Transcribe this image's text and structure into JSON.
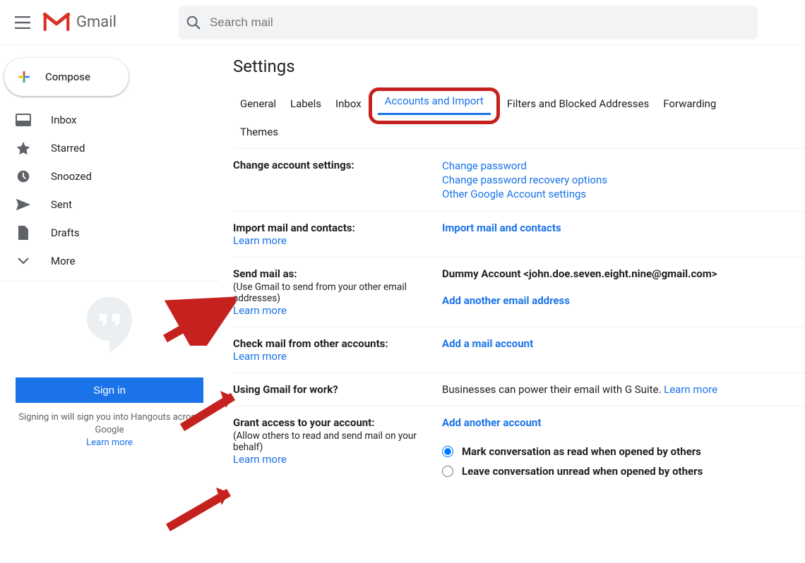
{
  "header": {
    "app_name": "Gmail",
    "search_placeholder": "Search mail"
  },
  "sidebar": {
    "compose_label": "Compose",
    "items": [
      {
        "label": "Inbox",
        "icon": "inbox-icon"
      },
      {
        "label": "Starred",
        "icon": "star-icon"
      },
      {
        "label": "Snoozed",
        "icon": "clock-icon"
      },
      {
        "label": "Sent",
        "icon": "send-icon"
      },
      {
        "label": "Drafts",
        "icon": "file-icon"
      },
      {
        "label": "More",
        "icon": "chevron-down-icon"
      }
    ],
    "signin_label": "Sign in",
    "hangouts_text_a": "Signing in will sign you into Hangouts across Google",
    "hangouts_learn": "Learn more"
  },
  "settings": {
    "title": "Settings",
    "tabs": {
      "general": "General",
      "labels": "Labels",
      "inbox": "Inbox",
      "accounts": "Accounts and Import",
      "filters": "Filters and Blocked Addresses",
      "forwarding": "Forwarding",
      "themes": "Themes"
    },
    "change_account": {
      "heading": "Change account settings:",
      "link1": "Change password",
      "link2": "Change password recovery options",
      "link3": "Other Google Account settings"
    },
    "import_mail": {
      "heading": "Import mail and contacts:",
      "learn": "Learn more",
      "action": "Import mail and contacts"
    },
    "send_as": {
      "heading": "Send mail as:",
      "sub": "(Use Gmail to send from your other email addresses)",
      "learn": "Learn more",
      "account": "Dummy Account <john.doe.seven.eight.nine@gmail.com>",
      "add": "Add another email address"
    },
    "check_mail": {
      "heading": "Check mail from other accounts:",
      "learn": "Learn more",
      "add": "Add a mail account"
    },
    "work": {
      "heading": "Using Gmail for work?",
      "text": "Businesses can power their email with G Suite. ",
      "learn": "Learn more"
    },
    "grant": {
      "heading": "Grant access to your account:",
      "sub": "(Allow others to read and send mail on your behalf)",
      "learn": "Learn more",
      "add": "Add another account",
      "radio1": "Mark conversation as read when opened by others",
      "radio2": "Leave conversation unread when opened by others"
    }
  }
}
